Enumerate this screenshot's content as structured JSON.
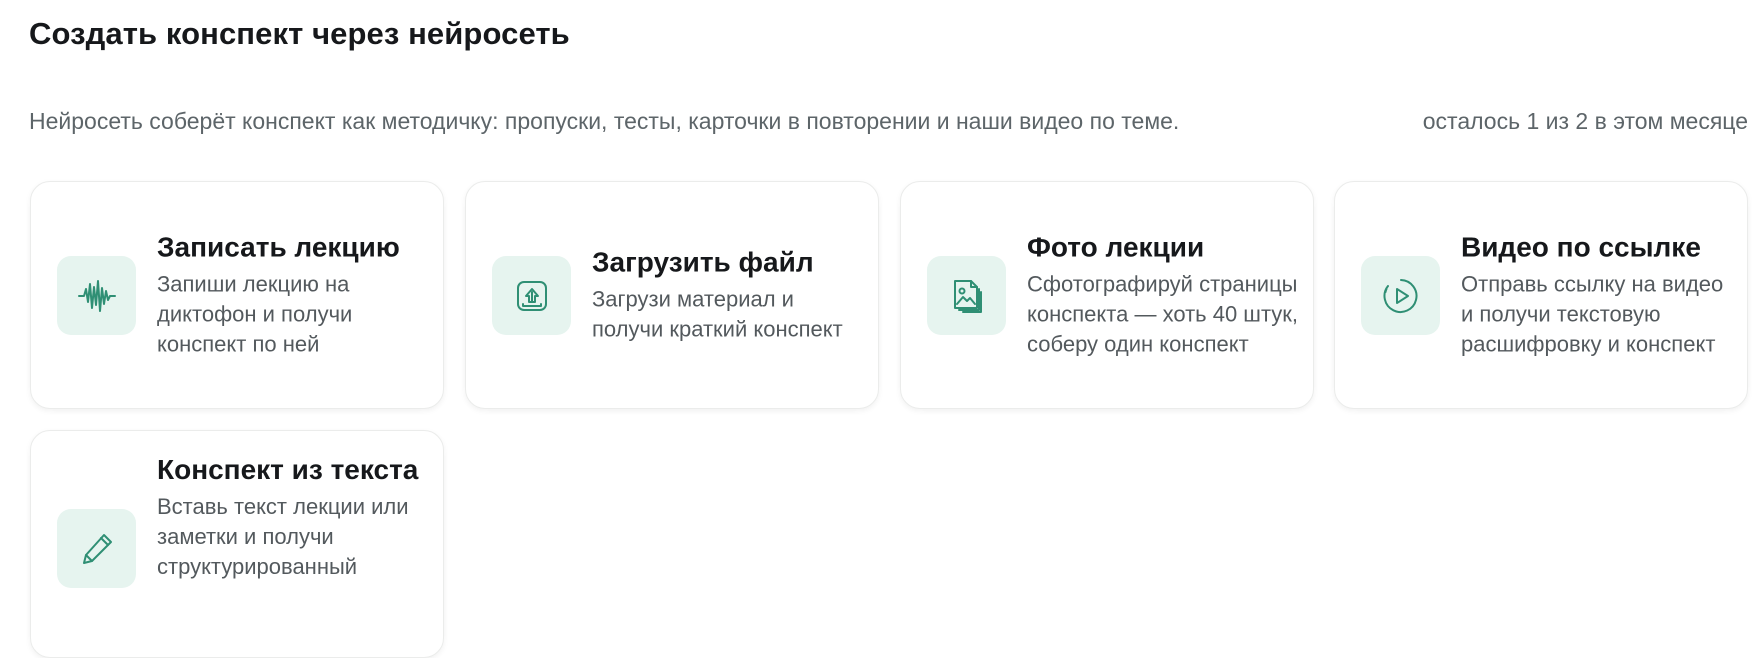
{
  "header": {
    "title": "Создать конспект через нейросеть",
    "subtitle": "Нейросеть соберёт конспект как методичку: пропуски, тесты, карточки в повторении и наши видео по теме.",
    "quota": "осталось 1 из 2 в этом месяце"
  },
  "cards": [
    {
      "title": "Записать лекцию",
      "description": "Запиши лекцию на диктофон и получи конспект по ней",
      "icon": "audio-waveform-icon"
    },
    {
      "title": "Загрузить файл",
      "description": "Загрузи материал и получи краткий конспект",
      "icon": "upload-file-icon"
    },
    {
      "title": "Фото лекции",
      "description": "Сфотографируй страницы конспекта — хоть 40 штук, соберу один конспект",
      "icon": "photo-pages-icon"
    },
    {
      "title": "Видео по ссылке",
      "description": "Отправь ссылку на видео и получи текстовую расшифровку и конспект",
      "icon": "play-circle-icon"
    },
    {
      "title": "Конспект из текста",
      "description": "Вставь текст лекции или заметки и получи структурированный",
      "icon": "pencil-icon"
    }
  ],
  "colors": {
    "accent": "#2f8f74",
    "icon_bg": "#e6f4ef",
    "title": "#16181b",
    "muted": "#5d6569"
  }
}
